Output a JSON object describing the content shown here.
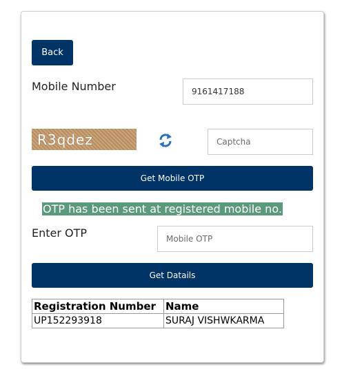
{
  "back_label": "Back",
  "mobile": {
    "label": "Mobile Number",
    "value": "9161417188"
  },
  "captcha": {
    "image_text": "R3qdez",
    "placeholder": "Captcha"
  },
  "get_otp_label": "Get Mobile OTP",
  "otp_message": "OTP has been sent at registered mobile no.",
  "otp": {
    "label": "Enter OTP",
    "placeholder": "Mobile OTP"
  },
  "get_details_label": "Get Datails",
  "table": {
    "headers": [
      "Registration Number",
      "Name"
    ],
    "rows": [
      [
        "UP152293918",
        "SURAJ VISHWKARMA"
      ]
    ]
  },
  "colors": {
    "primary": "#003366",
    "message_bg": "#5a9a7a",
    "refresh_icon": "#2a6fc4"
  },
  "icons": {
    "refresh": "refresh-icon"
  }
}
